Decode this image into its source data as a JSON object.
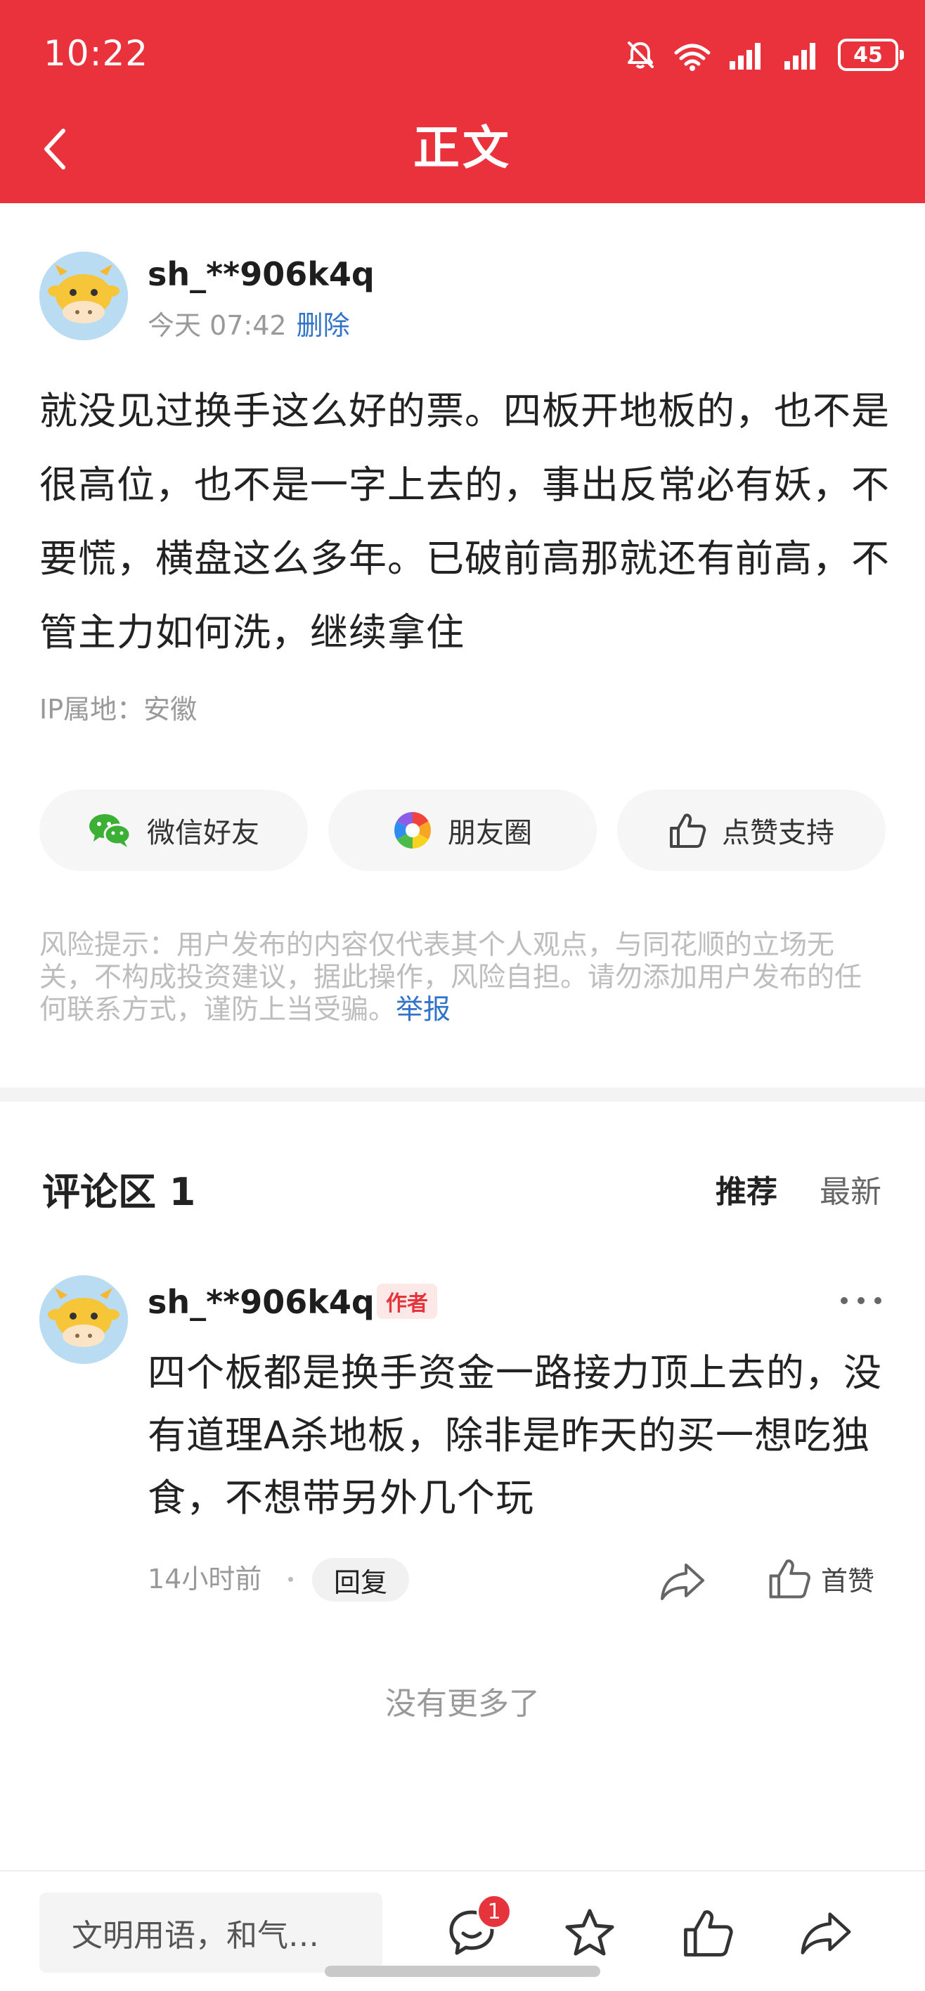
{
  "status_bar": {
    "time": "10:22",
    "battery": "45",
    "icons": [
      "mute-icon",
      "wifi-icon",
      "signal-icon",
      "signal-icon",
      "battery-icon"
    ]
  },
  "header": {
    "title": "正文",
    "color": "#e9323c"
  },
  "post": {
    "username": "sh_**906k4q",
    "time": "今天 07:42",
    "delete_label": "删除",
    "body": "就没见过换手这么好的票。四板开地板的，也不是很高位，也不是一字上去的，事出反常必有妖，不要慌，横盘这么多年。已破前高那就还有前高，不管主力如何洗，继续拿住",
    "ip_location": "IP属地：安徽"
  },
  "share_buttons": [
    {
      "label": "微信好友",
      "icon": "wechat-icon"
    },
    {
      "label": "朋友圈",
      "icon": "moments-icon"
    },
    {
      "label": "点赞支持",
      "icon": "thumbs-up-icon"
    }
  ],
  "disclaimer": {
    "text": "风险提示：用户发布的内容仅代表其个人观点，与同花顺的立场无关，不构成投资建议，据此操作，风险自担。请勿添加用户发布的任何联系方式，谨防上当受骗。",
    "report_label": "举报"
  },
  "comments": {
    "title": "评论区 1",
    "sort_recommended": "推荐",
    "sort_latest": "最新",
    "items": [
      {
        "username": "sh_**906k4q",
        "badge": "作者",
        "body": "四个板都是换手资金一路接力顶上去的，没有道理A杀地板，除非是昨天的买一想吃独食，不想带另外几个玩",
        "time": "14小时前",
        "reply_label": "回复",
        "like_label": "首赞"
      }
    ],
    "no_more": "没有更多了"
  },
  "bottom_bar": {
    "input_placeholder": "文明用语，和气…",
    "message_badge": "1"
  }
}
